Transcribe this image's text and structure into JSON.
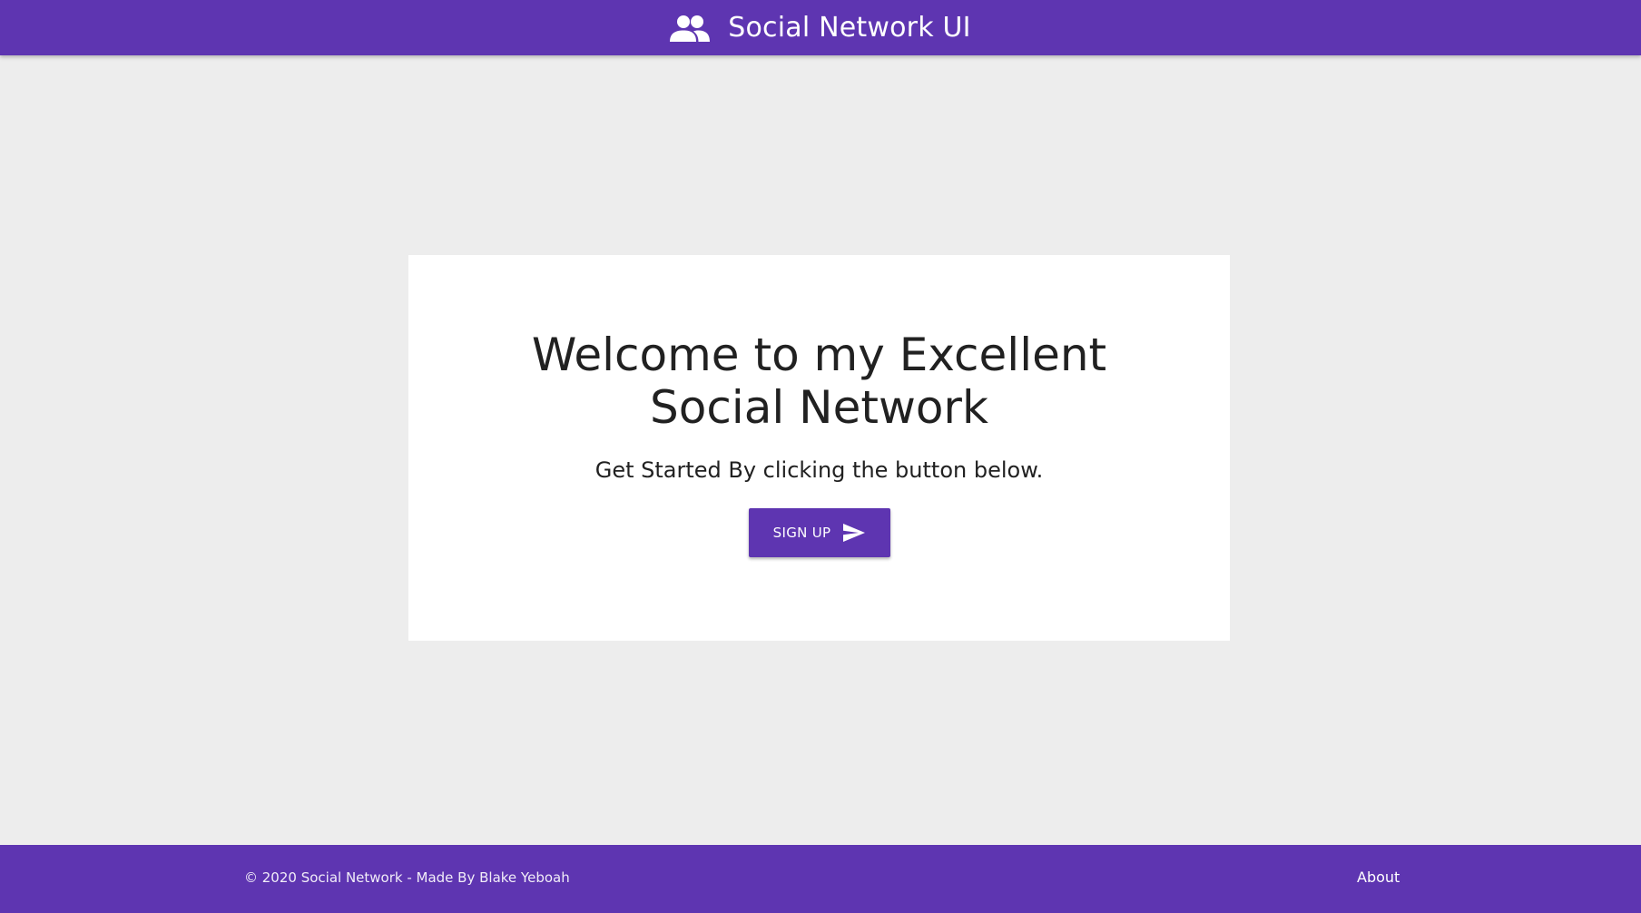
{
  "header": {
    "brand_icon": "people-icon",
    "title": "Social Network UI"
  },
  "hero": {
    "headline": "Welcome to my Excellent Social Network",
    "subtitle": "Get Started By clicking the button below.",
    "signup_label": "SIGN UP",
    "signup_icon": "send-icon"
  },
  "footer": {
    "copyright": "© 2020 Social Network - Made By Blake Yeboah",
    "about_label": "About"
  },
  "colors": {
    "primary": "#5e35b1",
    "background": "#ededed",
    "card": "#ffffff",
    "text": "#212121"
  }
}
